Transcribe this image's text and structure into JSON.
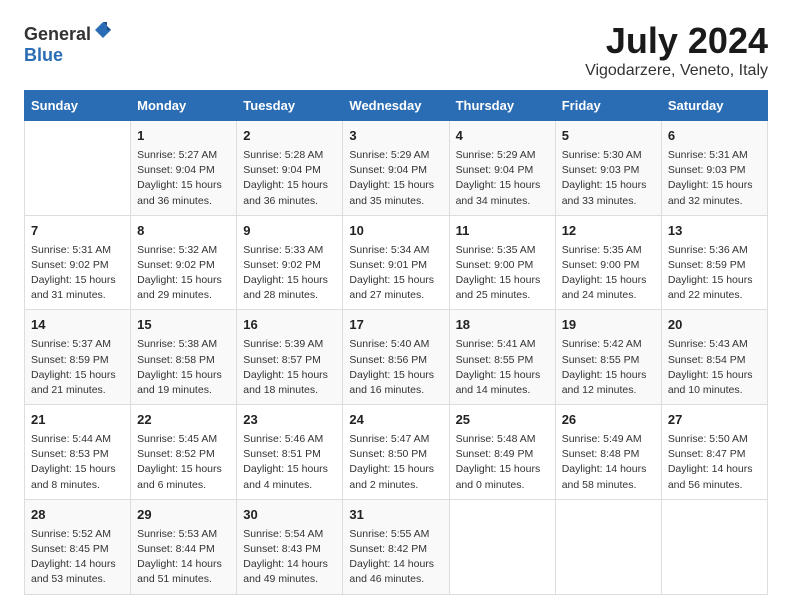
{
  "header": {
    "logo_general": "General",
    "logo_blue": "Blue",
    "month_year": "July 2024",
    "location": "Vigodarzere, Veneto, Italy"
  },
  "calendar": {
    "days_of_week": [
      "Sunday",
      "Monday",
      "Tuesday",
      "Wednesday",
      "Thursday",
      "Friday",
      "Saturday"
    ],
    "weeks": [
      [
        {
          "day": "",
          "content": ""
        },
        {
          "day": "1",
          "content": "Sunrise: 5:27 AM\nSunset: 9:04 PM\nDaylight: 15 hours\nand 36 minutes."
        },
        {
          "day": "2",
          "content": "Sunrise: 5:28 AM\nSunset: 9:04 PM\nDaylight: 15 hours\nand 36 minutes."
        },
        {
          "day": "3",
          "content": "Sunrise: 5:29 AM\nSunset: 9:04 PM\nDaylight: 15 hours\nand 35 minutes."
        },
        {
          "day": "4",
          "content": "Sunrise: 5:29 AM\nSunset: 9:04 PM\nDaylight: 15 hours\nand 34 minutes."
        },
        {
          "day": "5",
          "content": "Sunrise: 5:30 AM\nSunset: 9:03 PM\nDaylight: 15 hours\nand 33 minutes."
        },
        {
          "day": "6",
          "content": "Sunrise: 5:31 AM\nSunset: 9:03 PM\nDaylight: 15 hours\nand 32 minutes."
        }
      ],
      [
        {
          "day": "7",
          "content": "Sunrise: 5:31 AM\nSunset: 9:02 PM\nDaylight: 15 hours\nand 31 minutes."
        },
        {
          "day": "8",
          "content": "Sunrise: 5:32 AM\nSunset: 9:02 PM\nDaylight: 15 hours\nand 29 minutes."
        },
        {
          "day": "9",
          "content": "Sunrise: 5:33 AM\nSunset: 9:02 PM\nDaylight: 15 hours\nand 28 minutes."
        },
        {
          "day": "10",
          "content": "Sunrise: 5:34 AM\nSunset: 9:01 PM\nDaylight: 15 hours\nand 27 minutes."
        },
        {
          "day": "11",
          "content": "Sunrise: 5:35 AM\nSunset: 9:00 PM\nDaylight: 15 hours\nand 25 minutes."
        },
        {
          "day": "12",
          "content": "Sunrise: 5:35 AM\nSunset: 9:00 PM\nDaylight: 15 hours\nand 24 minutes."
        },
        {
          "day": "13",
          "content": "Sunrise: 5:36 AM\nSunset: 8:59 PM\nDaylight: 15 hours\nand 22 minutes."
        }
      ],
      [
        {
          "day": "14",
          "content": "Sunrise: 5:37 AM\nSunset: 8:59 PM\nDaylight: 15 hours\nand 21 minutes."
        },
        {
          "day": "15",
          "content": "Sunrise: 5:38 AM\nSunset: 8:58 PM\nDaylight: 15 hours\nand 19 minutes."
        },
        {
          "day": "16",
          "content": "Sunrise: 5:39 AM\nSunset: 8:57 PM\nDaylight: 15 hours\nand 18 minutes."
        },
        {
          "day": "17",
          "content": "Sunrise: 5:40 AM\nSunset: 8:56 PM\nDaylight: 15 hours\nand 16 minutes."
        },
        {
          "day": "18",
          "content": "Sunrise: 5:41 AM\nSunset: 8:55 PM\nDaylight: 15 hours\nand 14 minutes."
        },
        {
          "day": "19",
          "content": "Sunrise: 5:42 AM\nSunset: 8:55 PM\nDaylight: 15 hours\nand 12 minutes."
        },
        {
          "day": "20",
          "content": "Sunrise: 5:43 AM\nSunset: 8:54 PM\nDaylight: 15 hours\nand 10 minutes."
        }
      ],
      [
        {
          "day": "21",
          "content": "Sunrise: 5:44 AM\nSunset: 8:53 PM\nDaylight: 15 hours\nand 8 minutes."
        },
        {
          "day": "22",
          "content": "Sunrise: 5:45 AM\nSunset: 8:52 PM\nDaylight: 15 hours\nand 6 minutes."
        },
        {
          "day": "23",
          "content": "Sunrise: 5:46 AM\nSunset: 8:51 PM\nDaylight: 15 hours\nand 4 minutes."
        },
        {
          "day": "24",
          "content": "Sunrise: 5:47 AM\nSunset: 8:50 PM\nDaylight: 15 hours\nand 2 minutes."
        },
        {
          "day": "25",
          "content": "Sunrise: 5:48 AM\nSunset: 8:49 PM\nDaylight: 15 hours\nand 0 minutes."
        },
        {
          "day": "26",
          "content": "Sunrise: 5:49 AM\nSunset: 8:48 PM\nDaylight: 14 hours\nand 58 minutes."
        },
        {
          "day": "27",
          "content": "Sunrise: 5:50 AM\nSunset: 8:47 PM\nDaylight: 14 hours\nand 56 minutes."
        }
      ],
      [
        {
          "day": "28",
          "content": "Sunrise: 5:52 AM\nSunset: 8:45 PM\nDaylight: 14 hours\nand 53 minutes."
        },
        {
          "day": "29",
          "content": "Sunrise: 5:53 AM\nSunset: 8:44 PM\nDaylight: 14 hours\nand 51 minutes."
        },
        {
          "day": "30",
          "content": "Sunrise: 5:54 AM\nSunset: 8:43 PM\nDaylight: 14 hours\nand 49 minutes."
        },
        {
          "day": "31",
          "content": "Sunrise: 5:55 AM\nSunset: 8:42 PM\nDaylight: 14 hours\nand 46 minutes."
        },
        {
          "day": "",
          "content": ""
        },
        {
          "day": "",
          "content": ""
        },
        {
          "day": "",
          "content": ""
        }
      ]
    ]
  }
}
